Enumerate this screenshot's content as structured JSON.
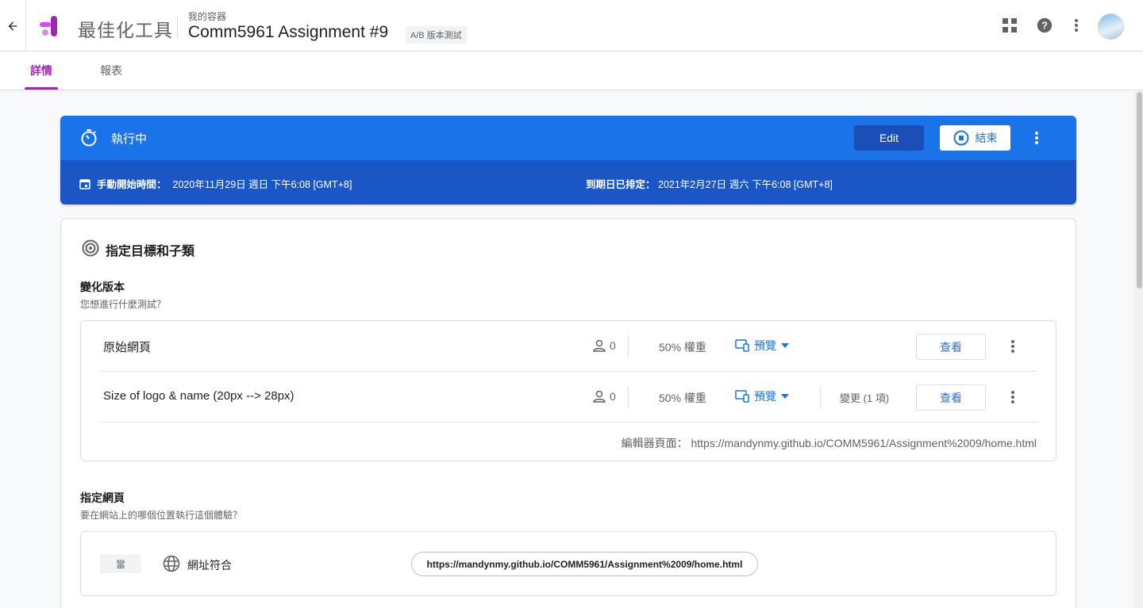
{
  "header": {
    "product_name": "最佳化工具",
    "container_label": "我的容器",
    "experiment_title": "Comm5961 Assignment #9",
    "experiment_type": "A/B 版本測試"
  },
  "tabs": [
    {
      "label": "詳情",
      "active": true
    },
    {
      "label": "報表",
      "active": false
    }
  ],
  "status": {
    "label": "執行中",
    "edit_label": "Edit",
    "end_label": "結束",
    "start_title": "手動開始時間：",
    "start_value": "2020年11月29日 週日 下午6:08 [GMT+8]",
    "end_title": "到期日已排定：",
    "end_value": "2021年2月27日 週六 下午6:08 [GMT+8]"
  },
  "objectives": {
    "title": "指定目標和子類",
    "variants_title": "變化版本",
    "variants_desc": "您想進行什麼測試？",
    "variants": [
      {
        "name": "原始網頁",
        "users": "0",
        "weight": "50% 權重",
        "preview_label": "預覽",
        "changes": "",
        "view_label": "查看"
      },
      {
        "name": "Size of logo & name (20px --> 28px)",
        "users": "0",
        "weight": "50% 權重",
        "preview_label": "預覽",
        "changes": "變更 (1 項)",
        "view_label": "查看"
      }
    ],
    "editor_page": "編輯器頁面： https://mandynmy.github.io/COMM5961/Assignment%2009/home.html",
    "targeting_title": "指定網頁",
    "targeting_desc": "要在網站上的哪個位置執行這個體驗？",
    "when_label": "當",
    "match_label": "網址符合",
    "match_url": "https://mandynmy.github.io/COMM5961/Assignment%2009/home.html"
  },
  "colors": {
    "accent": "#9c27b0",
    "primary": "#1a73e8",
    "status_bar": "#1a56c6"
  }
}
